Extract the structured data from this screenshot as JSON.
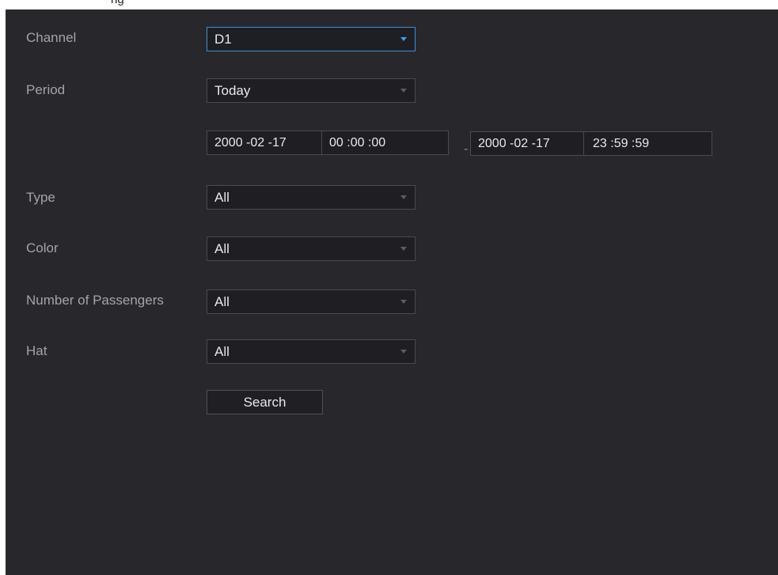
{
  "header": {
    "partial_title": "ng"
  },
  "form": {
    "channel": {
      "label": "Channel",
      "value": "D1"
    },
    "period": {
      "label": "Period",
      "value": "Today",
      "start_date": "2000 -02 -17",
      "start_time": "00 :00 :00",
      "separator": "-",
      "end_date": "2000 -02 -17",
      "end_time": "23 :59 :59"
    },
    "type": {
      "label": "Type",
      "value": "All"
    },
    "color": {
      "label": "Color",
      "value": "All"
    },
    "passengers": {
      "label": "Number of Passengers",
      "value": "All"
    },
    "hat": {
      "label": "Hat",
      "value": "All"
    },
    "search_label": "Search"
  },
  "colors": {
    "accent": "#3f8fd6",
    "panel_bg": "#28282c",
    "label": "#a4a4a8"
  },
  "icons": {
    "dropdown": "chevron-down-icon"
  }
}
